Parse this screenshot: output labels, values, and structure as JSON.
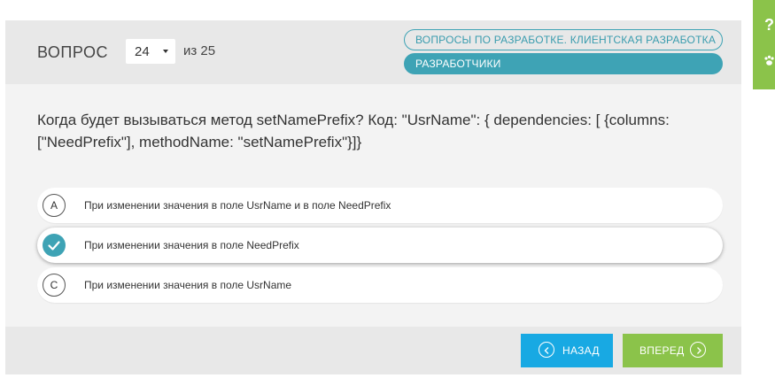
{
  "header": {
    "question_label": "ВОПРОС",
    "current_number": "24",
    "total_text": "из 25",
    "tags": [
      "ВОПРОСЫ ПО РАЗРАБОТКЕ. КЛИЕНТСКАЯ РАЗРАБОТКА",
      "РАЗРАБОТЧИКИ"
    ]
  },
  "question": {
    "text": "Когда будет вызываться метод setNamePrefix? Код: \"UsrName\": { dependencies: [ {columns: [\"NeedPrefix\"], methodName: \"setNamePrefix\"}]}"
  },
  "answers": [
    {
      "letter": "A",
      "text": "При изменении значения в поле UsrName и в поле NeedPrefix",
      "selected": false
    },
    {
      "letter": "B",
      "text": "При изменении значения в поле NeedPrefix",
      "selected": true
    },
    {
      "letter": "C",
      "text": "При изменении значения в поле UsrName",
      "selected": false
    }
  ],
  "footer": {
    "back_label": "НАЗАД",
    "next_label": "ВПЕРЕД"
  },
  "side_tab": {
    "help_glyph": "?",
    "icon": "paw-icon"
  },
  "colors": {
    "accent_teal": "#3ea3b5",
    "back_button": "#18a9e3",
    "next_button": "#8bc34a"
  }
}
